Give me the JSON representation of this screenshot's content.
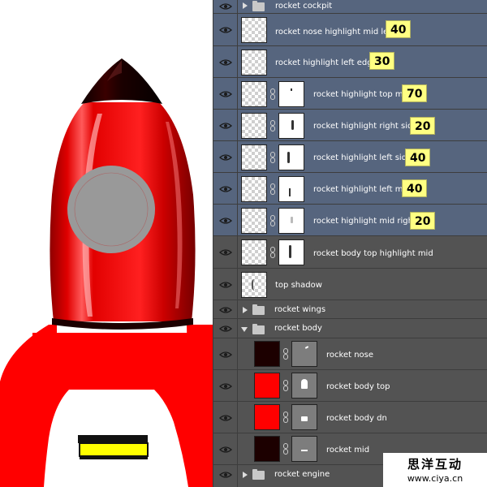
{
  "layers_panel": {
    "layers": [
      {
        "name": "rocket cockpit",
        "kind": "group",
        "expanded": false,
        "selected": true
      },
      {
        "name": "rocket nose highlight mid left",
        "kind": "layer",
        "selected": true,
        "opacity_note": "40"
      },
      {
        "name": "rocket highlight left edge",
        "kind": "layer",
        "selected": true,
        "opacity_note": "30"
      },
      {
        "name": "rocket highlight top mid",
        "kind": "masked",
        "selected": true,
        "opacity_note": "70"
      },
      {
        "name": "rocket highlight right side",
        "kind": "masked",
        "selected": true,
        "opacity_note": "20"
      },
      {
        "name": "rocket highlight left side",
        "kind": "masked",
        "selected": true,
        "opacity_note": "40"
      },
      {
        "name": "rocket highlight left mid",
        "kind": "masked",
        "selected": true,
        "opacity_note": "40"
      },
      {
        "name": "rocket highlight mid right",
        "kind": "masked",
        "selected": true,
        "opacity_note": "20"
      },
      {
        "name": "rocket body top highlight mid",
        "kind": "masked",
        "selected": false
      },
      {
        "name": "top shadow",
        "kind": "layer",
        "selected": false
      },
      {
        "name": "rocket wings",
        "kind": "group",
        "expanded": false,
        "selected": false
      },
      {
        "name": "rocket body",
        "kind": "group",
        "expanded": true,
        "selected": false
      },
      {
        "name": "rocket nose",
        "kind": "fill",
        "selected": false,
        "swatch": "#1c0000"
      },
      {
        "name": "rocket body top",
        "kind": "fill",
        "selected": false,
        "swatch": "#ff0000"
      },
      {
        "name": "rocket body dn",
        "kind": "fill",
        "selected": false,
        "swatch": "#ff0000"
      },
      {
        "name": "rocket mid",
        "kind": "fill",
        "selected": false,
        "swatch": "#1c0000"
      },
      {
        "name": "rocket engine",
        "kind": "group",
        "expanded": false,
        "selected": false
      }
    ]
  },
  "watermark": {
    "chinese": "思洋互动",
    "url": "www.ciya.cn"
  },
  "colors": {
    "panel_bg": "#535353",
    "selected_bg": "#56657e",
    "badge_bg": "#ffff82",
    "rocket_red": "#ff0000",
    "rocket_dark": "#1c0000",
    "window_grey": "#999999",
    "engine_yellow": "#ffff00"
  }
}
